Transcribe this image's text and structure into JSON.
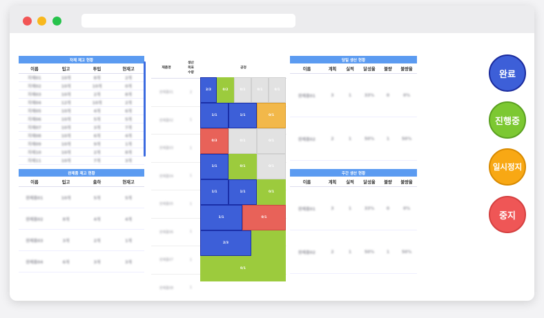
{
  "colors": {
    "header_blue": "#5b9bf1",
    "complete": "#3d5fd8",
    "in_progress": "#7cc832",
    "paused": "#f8a814",
    "stopped": "#ef5656"
  },
  "material": {
    "title": "자재 재고 현황",
    "columns": [
      "이름",
      "입고",
      "투입",
      "현재고"
    ],
    "rows": [
      [
        "자재01",
        "10개",
        "8개",
        "2개"
      ],
      [
        "자재02",
        "10개",
        "10개",
        "0개"
      ],
      [
        "자재03",
        "10개",
        "2개",
        "8개"
      ],
      [
        "자재04",
        "12개",
        "10개",
        "2개"
      ],
      [
        "자재05",
        "10개",
        "4개",
        "6개"
      ],
      [
        "자재06",
        "10개",
        "5개",
        "5개"
      ],
      [
        "자재07",
        "10개",
        "3개",
        "7개"
      ],
      [
        "자재08",
        "10개",
        "6개",
        "4개"
      ],
      [
        "자재09",
        "10개",
        "9개",
        "1개"
      ],
      [
        "자재10",
        "10개",
        "2개",
        "8개"
      ],
      [
        "자재11",
        "10개",
        "7개",
        "3개"
      ]
    ]
  },
  "finished": {
    "title": "완제품 재고 현황",
    "columns": [
      "이름",
      "입고",
      "출하",
      "현재고"
    ],
    "rows": [
      [
        "완제품01",
        "10개",
        "5개",
        "5개"
      ],
      [
        "완제품02",
        "8개",
        "4개",
        "4개"
      ],
      [
        "완제품03",
        "3개",
        "2개",
        "1개"
      ],
      [
        "완제품04",
        "6개",
        "3개",
        "3개"
      ]
    ]
  },
  "process": {
    "columns": [
      "제품명",
      "생산\n목표\n수량",
      "공정"
    ],
    "rows": [
      {
        "name": "완제품01",
        "qty": "2"
      },
      {
        "name": "완제품02",
        "qty": "1"
      },
      {
        "name": "완제품03",
        "qty": "1"
      },
      {
        "name": "완제품04",
        "qty": "1"
      },
      {
        "name": "완제품05",
        "qty": "1"
      },
      {
        "name": "완제품06",
        "qty": "1"
      },
      {
        "name": "완제품07",
        "qty": "1"
      },
      {
        "name": "완제품08",
        "qty": "1"
      }
    ],
    "gantt": [
      [
        {
          "l": "2/2",
          "c": "blue"
        },
        {
          "l": "0/2",
          "c": "green"
        },
        {
          "l": "0/1",
          "c": "gray"
        },
        {
          "l": "0/1",
          "c": "gray"
        },
        {
          "l": "0/1",
          "c": "gray"
        }
      ],
      [
        {
          "l": "1/1",
          "c": "blue"
        },
        {
          "l": "1/1",
          "c": "blue"
        },
        {
          "l": "0/1",
          "c": "orange"
        }
      ],
      [
        {
          "l": "0/3",
          "c": "red"
        },
        {
          "l": "0/1",
          "c": "gray"
        },
        {
          "l": "0/1",
          "c": "gray"
        }
      ],
      [
        {
          "l": "1/1",
          "c": "blue"
        },
        {
          "l": "0/1",
          "c": "green"
        },
        {
          "l": "0/1",
          "c": "gray"
        }
      ],
      [
        {
          "l": "1/1",
          "c": "blue"
        },
        {
          "l": "1/1",
          "c": "blue"
        },
        {
          "l": "0/1",
          "c": "green"
        }
      ],
      [
        {
          "l": "1/1",
          "c": "blue"
        },
        {
          "l": "0/1",
          "c": "red"
        }
      ],
      [
        {
          "l": "2/3",
          "c": "blue"
        },
        {
          "l": "",
          "c": "green"
        }
      ],
      [
        {
          "l": "0/1",
          "c": "green"
        }
      ]
    ]
  },
  "daily": {
    "title": "당일 생산 현황",
    "columns": [
      "이름",
      "계획",
      "실적",
      "달성율",
      "불량",
      "불량율"
    ],
    "rows": [
      [
        "완제품01",
        "3",
        "1",
        "33%",
        "0",
        "0%"
      ],
      [
        "완제품02",
        "2",
        "1",
        "50%",
        "1",
        "50%"
      ]
    ]
  },
  "weekly": {
    "title": "주간 생산 현황",
    "columns": [
      "이름",
      "계획",
      "실적",
      "달성율",
      "불량",
      "불량율"
    ],
    "rows": [
      [
        "완제품01",
        "3",
        "1",
        "33%",
        "0",
        "0%"
      ],
      [
        "완제품02",
        "2",
        "1",
        "50%",
        "1",
        "50%"
      ]
    ]
  },
  "controls": {
    "complete": "완료",
    "in_progress": "진행중",
    "paused": "일시정지",
    "stopped": "중지"
  }
}
